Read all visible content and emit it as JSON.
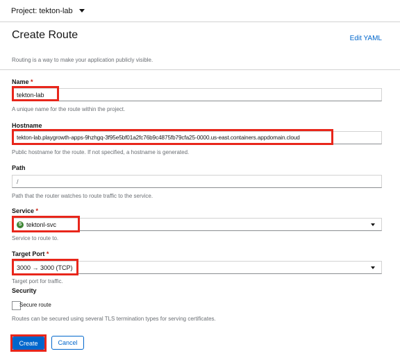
{
  "project_bar": {
    "label": "Project: tekton-lab",
    "caret_icon": "caret-down-icon"
  },
  "header": {
    "title": "Create Route",
    "edit_yaml": "Edit YAML",
    "intro": "Routing is a way to make your application publicly visible."
  },
  "form": {
    "name": {
      "label": "Name",
      "required": "*",
      "value": "tekton-lab",
      "helper": "A unique name for the route within the project."
    },
    "hostname": {
      "label": "Hostname",
      "value": "tekton-lab.playgrowth-apps-9hzhgq-3f95e5bf01a2fc76b9c4875fb79cfa25-0000.us-east.containers.appdomain.cloud",
      "helper": "Public hostname for the route. If not specified, a hostname is generated."
    },
    "path": {
      "label": "Path",
      "placeholder": "/",
      "helper": "Path that the router watches to route traffic to the service."
    },
    "service": {
      "label": "Service",
      "required": "*",
      "badge": "S",
      "value": "tektonl-svc",
      "helper": "Service to route to."
    },
    "target_port": {
      "label": "Target Port",
      "required": "*",
      "value": "3000 → 3000 (TCP)",
      "helper": "Target port for traffic."
    },
    "security": {
      "title": "Security",
      "checkbox_label": "Secure route",
      "helper": "Routes can be secured using several TLS termination types for serving certificates."
    }
  },
  "actions": {
    "create": "Create",
    "cancel": "Cancel"
  },
  "colors": {
    "link": "#0066cc",
    "primary": "#0066cc",
    "required": "#c9190b",
    "highlight": "#e8261b",
    "service_badge": "#3e8635"
  }
}
